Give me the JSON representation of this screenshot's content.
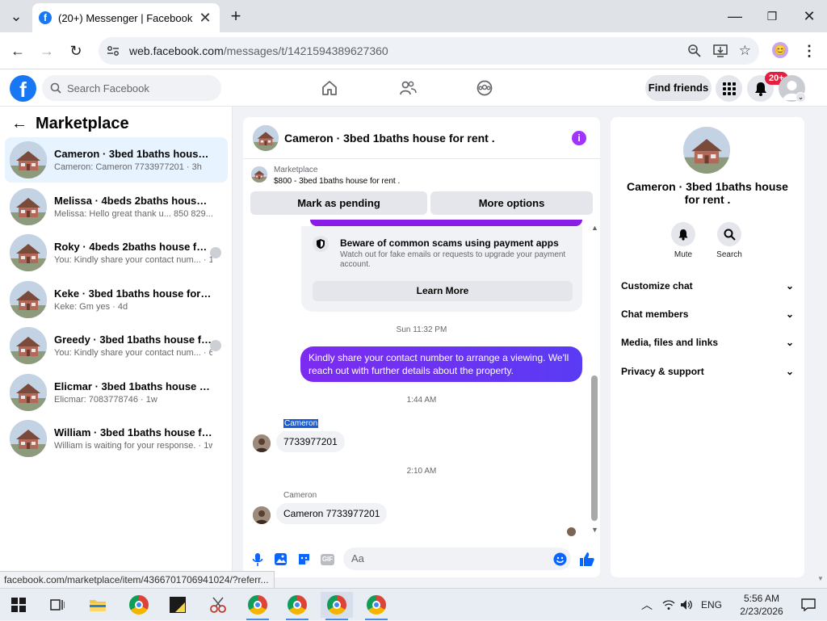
{
  "browser": {
    "tab_title": "(20+) Messenger | Facebook",
    "url_host": "web.facebook.com",
    "url_path": "/messages/t/1421594389627360"
  },
  "fb_header": {
    "search_placeholder": "Search Facebook",
    "find_friends": "Find friends",
    "notif_badge": "20+"
  },
  "sidebar": {
    "title": "Marketplace",
    "conversations": [
      {
        "name": "Cameron · 3bed 1baths house for r...",
        "preview": "Cameron: Cameron 7733977201 · 3h"
      },
      {
        "name": "Melissa · 4beds 2baths house for r...",
        "preview": "Melissa: Hello great thank u... 850 829... · 1d"
      },
      {
        "name": "Roky · 4beds 2baths house for r...",
        "preview": "You: Kindly share your contact num... · 1d"
      },
      {
        "name": "Keke · 3bed 1baths house for rent .",
        "preview": "Keke: Gm yes · 4d"
      },
      {
        "name": "Greedy · 3bed 1baths house for ...",
        "preview": "You: Kindly share your contact num... · 6d"
      },
      {
        "name": "Elicmar · 3bed 1baths house for re...",
        "preview": "Elicmar: 7083778746 · 1w"
      },
      {
        "name": "William · 3bed 1baths house for re...",
        "preview": "William is waiting for your response. · 1w"
      }
    ]
  },
  "chat": {
    "title": "Cameron · 3bed 1baths house for rent .",
    "marketplace_label": "Marketplace",
    "listing": "$800 - 3bed 1baths house for rent .",
    "mark_pending": "Mark as pending",
    "more_options": "More options",
    "warning_title": "Beware of common scams using payment apps",
    "warning_sub": "Watch out for fake emails or requests to upgrade your payment account.",
    "learn_more": "Learn More",
    "ts1": "Sun 11:32 PM",
    "my_message": "Kindly share your contact number to arrange a viewing. We'll reach out with further details about the property.",
    "ts2": "1:44 AM",
    "sender1": "Cameron",
    "msg1": "7733977201",
    "ts3": "2:10 AM",
    "sender2": "Cameron",
    "msg2": "Cameron 7733977201",
    "input_placeholder": "Aa"
  },
  "right_panel": {
    "name": "Cameron · 3bed 1baths house for rent .",
    "mute": "Mute",
    "search": "Search",
    "rows": [
      "Customize chat",
      "Chat members",
      "Media, files and links",
      "Privacy & support"
    ]
  },
  "status_url": "facebook.com/marketplace/item/4366701706941024/?referr...",
  "taskbar": {
    "lang": "ENG",
    "time": "5:56 AM",
    "date": "2/23/2026"
  },
  "colors": {
    "fb_blue": "#1877f2",
    "bubble_purple": "#6a33f2",
    "active_row": "#e7f3ff"
  }
}
